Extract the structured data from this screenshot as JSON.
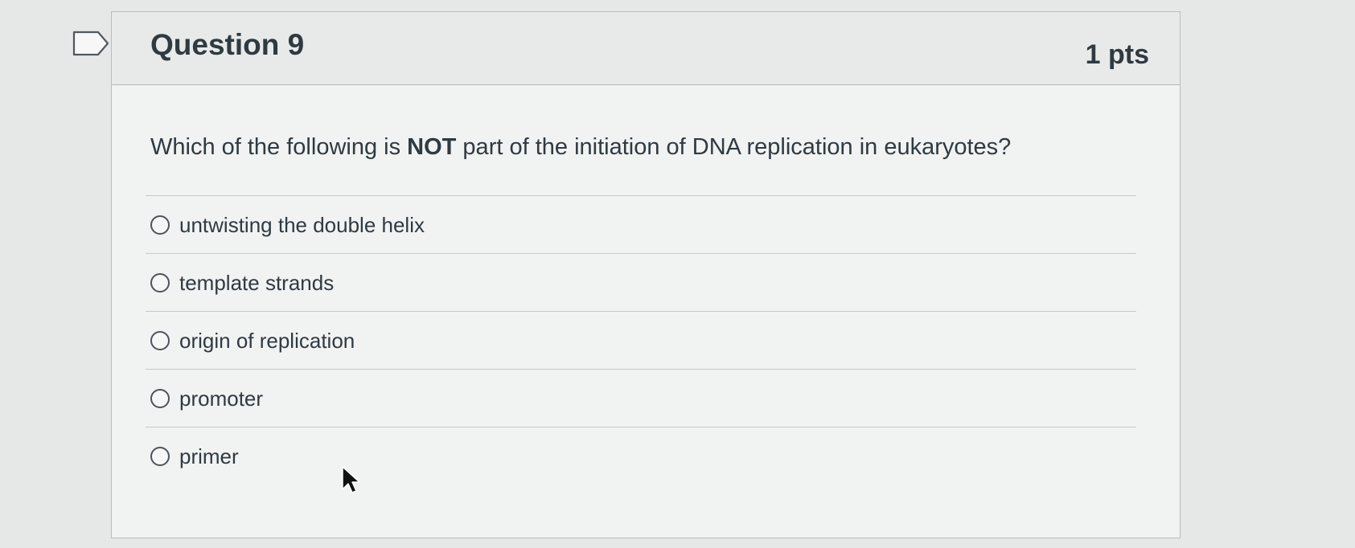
{
  "question": {
    "title": "Question 9",
    "points": "1 pts",
    "text_before": "Which of the following is ",
    "text_emphasis": "NOT",
    "text_after": " part of the initiation of DNA replication in eukaryotes?"
  },
  "answers": [
    {
      "label": "untwisting the double helix",
      "selected": false
    },
    {
      "label": "template strands",
      "selected": false
    },
    {
      "label": "origin of replication",
      "selected": false
    },
    {
      "label": "promoter",
      "selected": false
    },
    {
      "label": "primer",
      "selected": false
    }
  ],
  "colors": {
    "page_background": "#e6e7e7",
    "card_background": "#f1f2f2",
    "header_background": "#e8eaea",
    "text": "#2f3a41",
    "border": "#b9bcbd"
  },
  "icons": {
    "flag": "flag-icon",
    "radio": "radio-icon",
    "cursor": "cursor-icon"
  }
}
